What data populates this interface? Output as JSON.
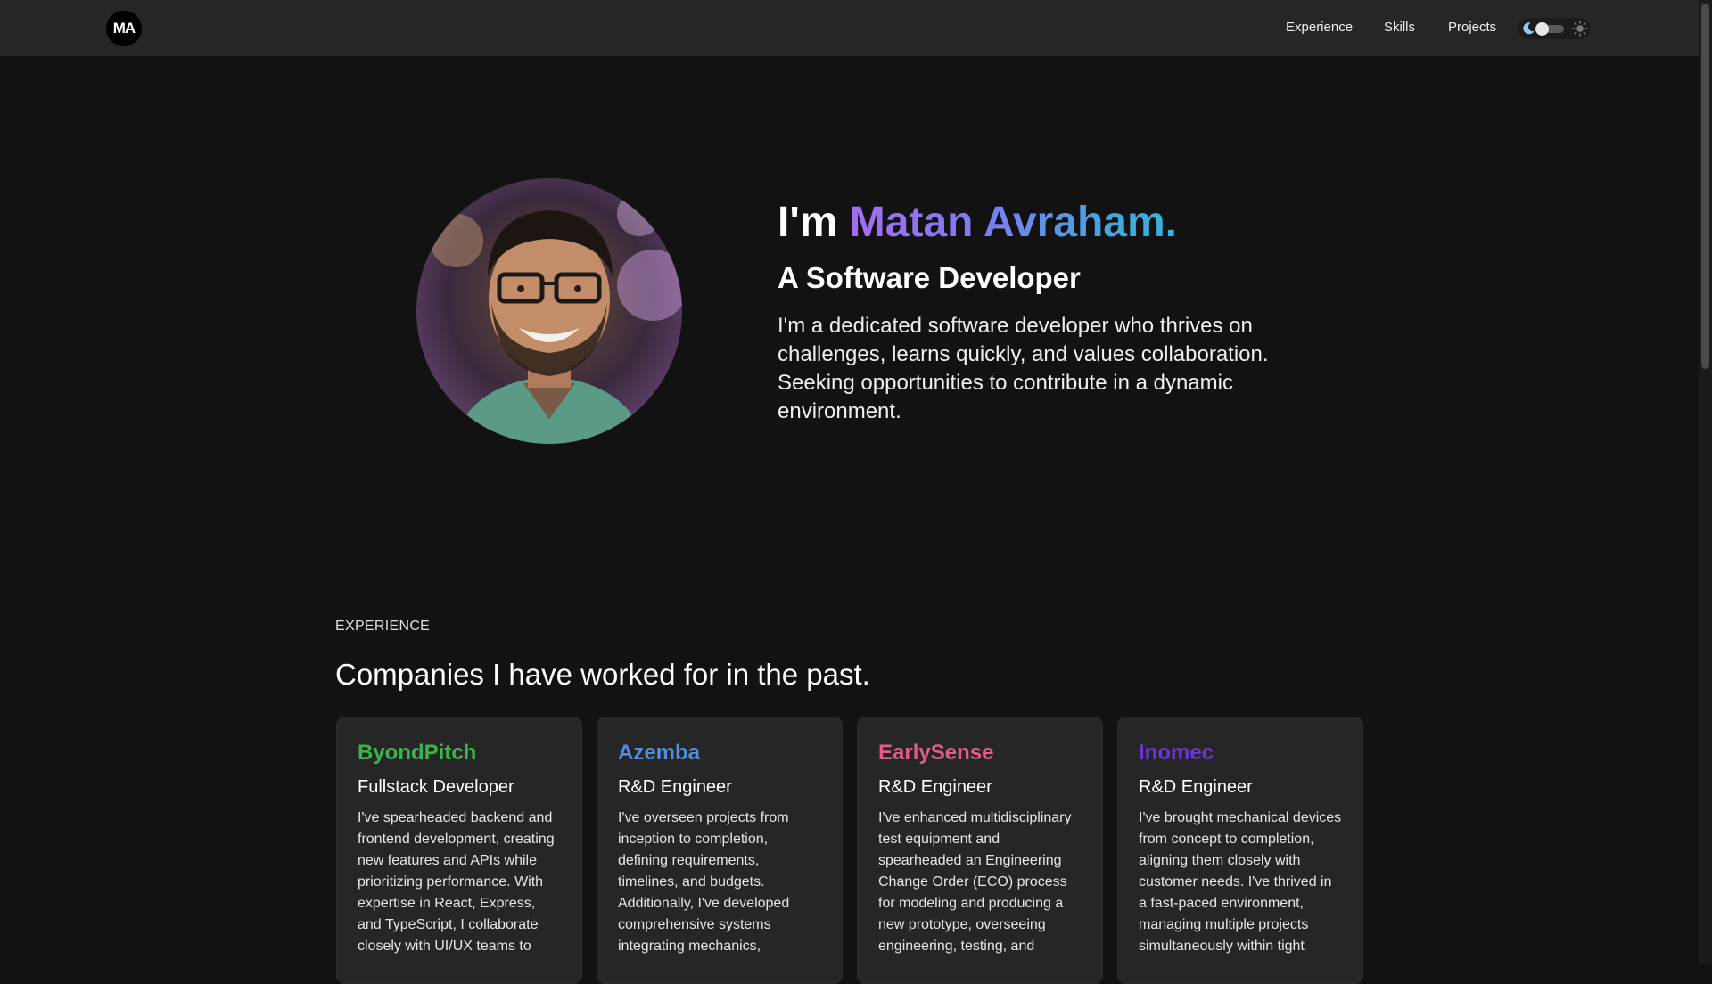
{
  "navbar": {
    "logo_text": "MA",
    "links": [
      "Experience",
      "Skills",
      "Projects"
    ],
    "theme_toggle": {
      "mode": "dark",
      "icons": [
        "moon-icon",
        "sun-icon"
      ]
    }
  },
  "hero": {
    "greeting": "I'm",
    "name": "Matan Avraham.",
    "subtitle": "A Software Developer",
    "description": "I'm a dedicated software developer who thrives on challenges, learns quickly, and values collaboration. Seeking opportunities to contribute in a dynamic environment."
  },
  "experience": {
    "eyebrow": "EXPERIENCE",
    "heading": "Companies I have worked for in the past.",
    "items": [
      {
        "company": "ByondPitch",
        "color": "#3bb54a",
        "role": "Fullstack Developer",
        "description": "I've spearheaded backend and frontend development, creating new features and APIs while prioritizing performance. With expertise in React, Express, and TypeScript, I collaborate closely with UI/UX teams to"
      },
      {
        "company": "Azemba",
        "color": "#4f8fe0",
        "role": "R&D Engineer",
        "description": "I've overseen projects from inception to completion, defining requirements, timelines, and budgets. Additionally, I've developed comprehensive systems integrating mechanics,"
      },
      {
        "company": "EarlySense",
        "color": "#e05d85",
        "role": "R&D Engineer",
        "description": "I've enhanced multidisciplinary test equipment and spearheaded an Engineering Change Order (ECO) process for modeling and producing a new prototype, overseeing engineering, testing, and"
      },
      {
        "company": "Inomec",
        "color": "#6a35d8",
        "role": "R&D Engineer",
        "description": "I've brought mechanical devices from concept to completion, aligning them closely with customer needs. I've thrived in a fast-paced environment, managing multiple projects simultaneously within tight"
      }
    ]
  }
}
